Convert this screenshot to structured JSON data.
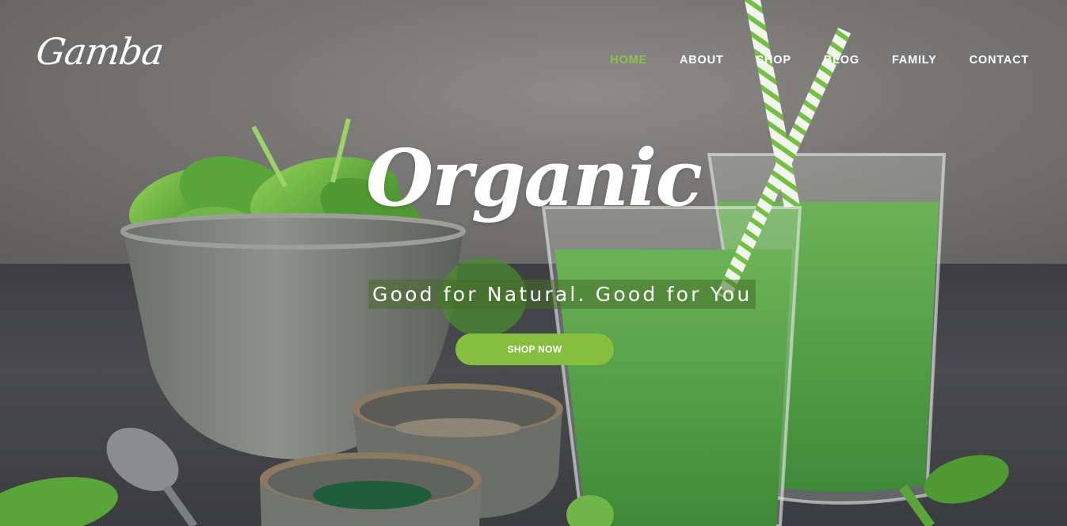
{
  "brand": {
    "logo_text": "Gamba"
  },
  "nav": {
    "items": [
      {
        "label": "HOME",
        "active": true
      },
      {
        "label": "ABOUT",
        "active": false
      },
      {
        "label": "SHOP",
        "active": false
      },
      {
        "label": "BLOG",
        "active": false
      },
      {
        "label": "FAMILY",
        "active": false
      },
      {
        "label": "CONTACT",
        "active": false
      }
    ]
  },
  "hero": {
    "headline": "Organic",
    "tagline": "Good for Natural. Good for You",
    "cta_label": "SHOP NOW"
  },
  "colors": {
    "accent": "#86bf40",
    "nav_active": "#8bc34a",
    "text": "#ffffff"
  }
}
